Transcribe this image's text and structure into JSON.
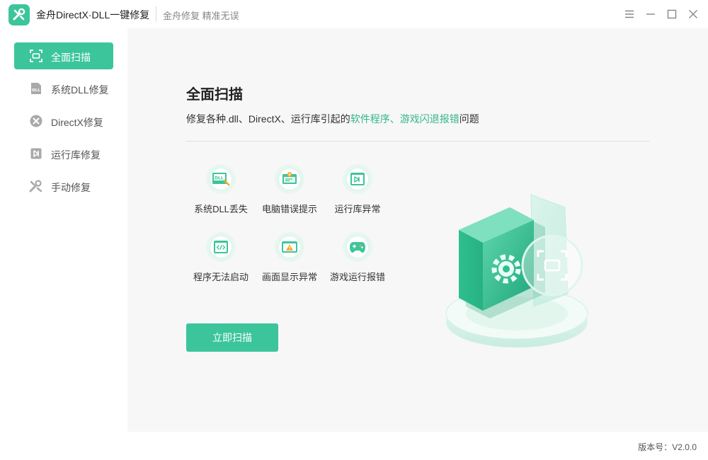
{
  "app": {
    "title": "金舟DirectX·DLL一键修复",
    "subtitle": "金舟修复 精准无误",
    "accent_color": "#3cc59a"
  },
  "window_controls": [
    {
      "name": "menu-icon"
    },
    {
      "name": "minimize-icon"
    },
    {
      "name": "maximize-icon"
    },
    {
      "name": "close-icon"
    }
  ],
  "sidebar": {
    "items": [
      {
        "label": "全面扫描",
        "icon": "scan-icon",
        "active": true
      },
      {
        "label": "系统DLL修复",
        "icon": "dll-icon",
        "active": false
      },
      {
        "label": "DirectX修复",
        "icon": "directx-icon",
        "active": false
      },
      {
        "label": "运行库修复",
        "icon": "runtime-icon",
        "active": false
      },
      {
        "label": "手动修复",
        "icon": "wrench-icon",
        "active": false
      }
    ]
  },
  "main": {
    "heading": "全面扫描",
    "desc_prefix": "修复各种.dll、DirectX、运行库引起的",
    "desc_highlight": "软件程序、游戏闪退报错",
    "desc_suffix": "问题",
    "features": [
      {
        "label": "系统DLL丢失",
        "icon": "dll-missing-icon"
      },
      {
        "label": "电脑错误提示",
        "icon": "error-prompt-icon"
      },
      {
        "label": "运行库异常",
        "icon": "runtime-error-icon"
      },
      {
        "label": "程序无法启动",
        "icon": "code-icon"
      },
      {
        "label": "画面显示异常",
        "icon": "display-warning-icon"
      },
      {
        "label": "游戏运行报错",
        "icon": "gamepad-icon"
      }
    ],
    "scan_button": "立即扫描"
  },
  "footer": {
    "version_label": "版本号：",
    "version": "V2.0.0"
  }
}
